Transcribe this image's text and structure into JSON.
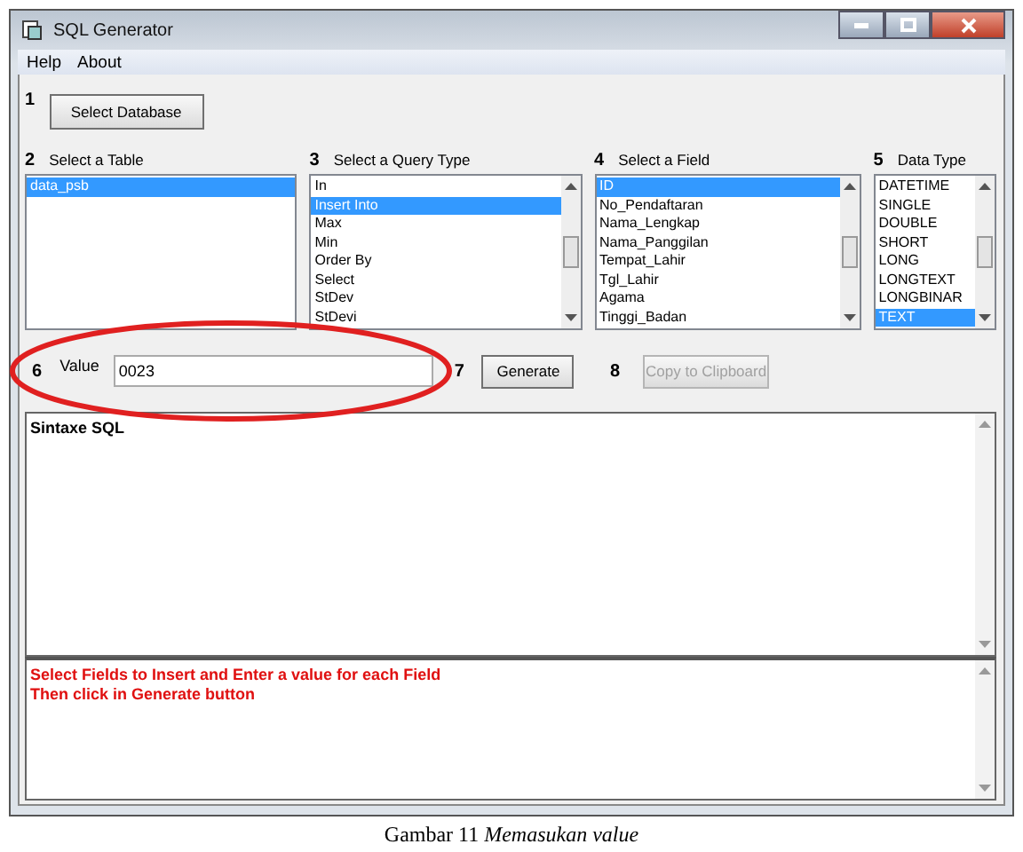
{
  "window": {
    "title": "SQL Generator"
  },
  "menu": [
    "Help",
    "About"
  ],
  "steps": {
    "select_database": {
      "number": "1",
      "button": "Select Database"
    },
    "lists": [
      {
        "number": "2",
        "label": "Select a Table",
        "scrollbar": false,
        "items": [
          {
            "text": "data_psb",
            "selected": true
          }
        ]
      },
      {
        "number": "3",
        "label": "Select a Query Type",
        "scrollbar": true,
        "items": [
          {
            "text": "In",
            "selected": false
          },
          {
            "text": "Insert Into",
            "selected": true
          },
          {
            "text": "Max",
            "selected": false
          },
          {
            "text": "Min",
            "selected": false
          },
          {
            "text": "Order By",
            "selected": false
          },
          {
            "text": "Select",
            "selected": false
          },
          {
            "text": "StDev",
            "selected": false
          },
          {
            "text": "StDevi",
            "selected": false
          }
        ]
      },
      {
        "number": "4",
        "label": "Select a Field",
        "scrollbar": true,
        "items": [
          {
            "text": "ID",
            "selected": true
          },
          {
            "text": "No_Pendaftaran",
            "selected": false
          },
          {
            "text": "Nama_Lengkap",
            "selected": false
          },
          {
            "text": "Nama_Panggilan",
            "selected": false
          },
          {
            "text": "Tempat_Lahir",
            "selected": false
          },
          {
            "text": "Tgl_Lahir",
            "selected": false
          },
          {
            "text": "Agama",
            "selected": false
          },
          {
            "text": "Tinggi_Badan",
            "selected": false
          }
        ]
      },
      {
        "number": "5",
        "label": "Data Type",
        "scrollbar": true,
        "items": [
          {
            "text": "DATETIME",
            "selected": false
          },
          {
            "text": "SINGLE",
            "selected": false
          },
          {
            "text": "DOUBLE",
            "selected": false
          },
          {
            "text": "SHORT",
            "selected": false
          },
          {
            "text": "LONG",
            "selected": false
          },
          {
            "text": "LONGTEXT",
            "selected": false
          },
          {
            "text": "LONGBINAR",
            "selected": false
          },
          {
            "text": "TEXT",
            "selected": true
          }
        ]
      }
    ],
    "value": {
      "number": "6",
      "label": "Value",
      "value": "0023"
    },
    "generate": {
      "number": "7",
      "button": "Generate",
      "disabled": false
    },
    "copy": {
      "number": "8",
      "button": "Copy to Clipboard",
      "disabled": true
    }
  },
  "sql_output": "Sintaxe SQL",
  "message": [
    "Select Fields to Insert and Enter a value for each Field",
    "Then click in Generate button"
  ],
  "caption": "Gambar 11 *Memasukan value*"
}
